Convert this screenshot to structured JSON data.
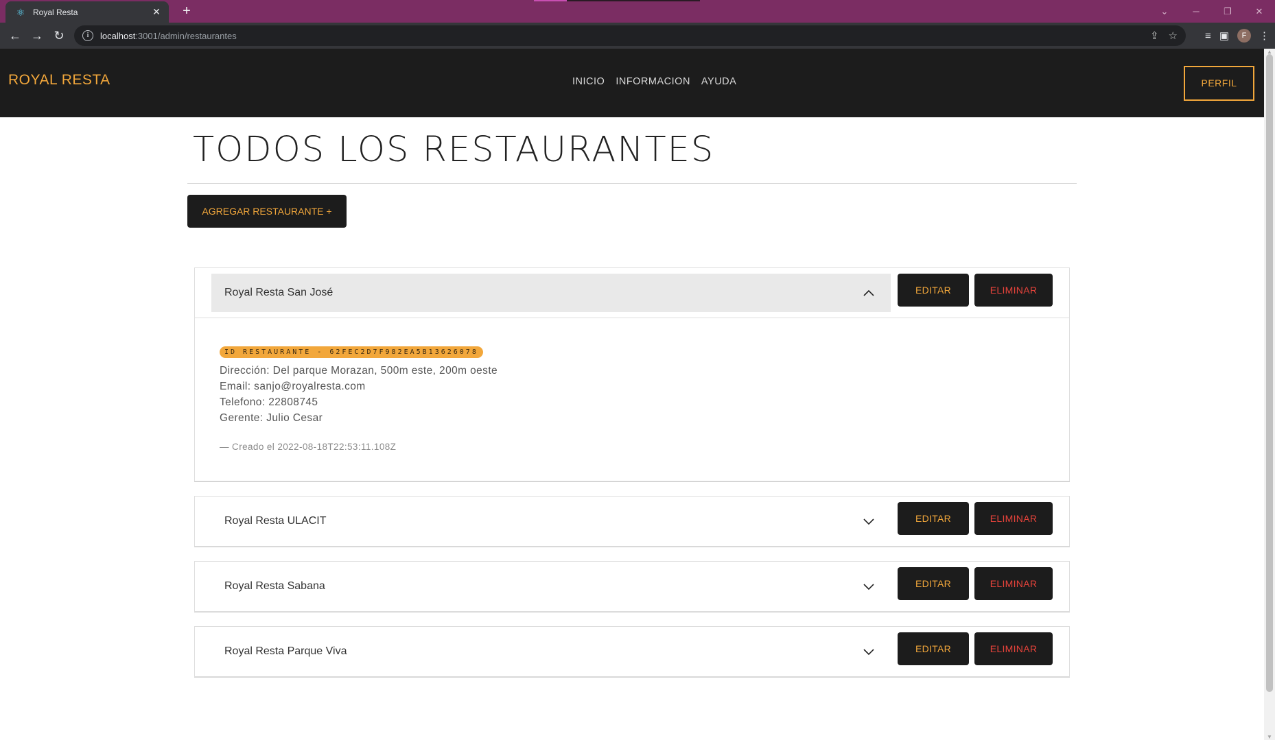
{
  "browser": {
    "tab_title": "Royal Resta",
    "new_tab_symbol": "+",
    "url_host": "localhost",
    "url_rest": ":3001/admin/restaurantes",
    "profile_initial": "F"
  },
  "header": {
    "brand": "ROYAL RESTA",
    "nav": [
      "INICIO",
      "INFORMACION",
      "AYUDA"
    ],
    "profile_button": "PERFIL"
  },
  "page": {
    "title": "TODOS LOS RESTAURANTES",
    "add_button": "AGREGAR RESTAURANTE +"
  },
  "restaurants": [
    {
      "name": "Royal Resta San José",
      "expanded": true,
      "edit_label": "EDITAR",
      "delete_label": "ELIMINAR",
      "id_badge": "ID RESTAURANTE - 62FEC2D7F982EA5B13626078",
      "direccion": "Dirección: Del parque Morazan, 500m este, 200m oeste",
      "email": "Email: sanjo@royalresta.com",
      "telefono": "Telefono: 22808745",
      "gerente": "Gerente: Julio Cesar",
      "created": "— Creado el 2022-08-18T22:53:11.108Z"
    },
    {
      "name": "Royal Resta ULACIT",
      "expanded": false,
      "edit_label": "EDITAR",
      "delete_label": "ELIMINAR"
    },
    {
      "name": "Royal Resta Sabana",
      "expanded": false,
      "edit_label": "EDITAR",
      "delete_label": "ELIMINAR"
    },
    {
      "name": "Royal Resta Parque Viva",
      "expanded": false,
      "edit_label": "EDITAR",
      "delete_label": "ELIMINAR"
    }
  ],
  "colors": {
    "accent": "#f2a73b",
    "danger": "#e8433b",
    "header_bg": "#1c1c1c",
    "tabbar_bg": "#7b2d63"
  }
}
